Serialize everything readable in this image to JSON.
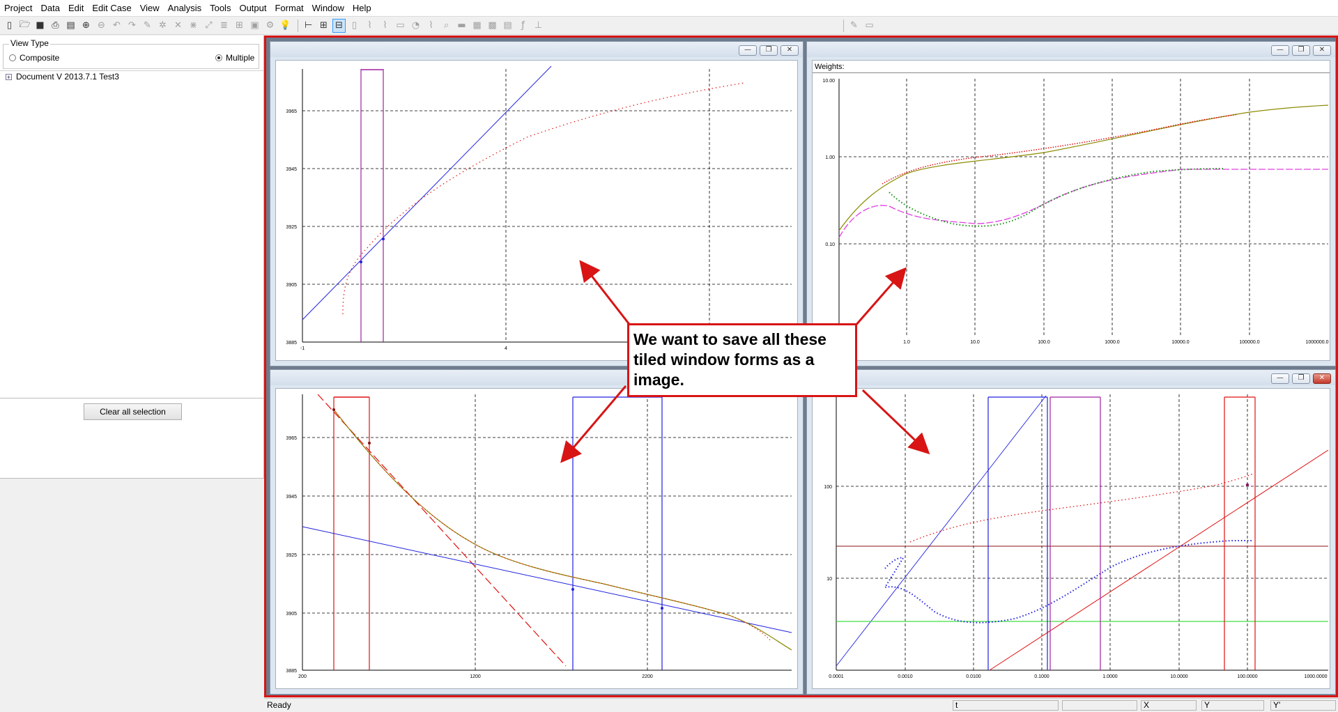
{
  "menu": [
    "Project",
    "Data",
    "Edit",
    "Edit Case",
    "View",
    "Analysis",
    "Tools",
    "Output",
    "Format",
    "Window",
    "Help"
  ],
  "left_panel": {
    "view_type_title": "View Type",
    "option_composite": "Composite",
    "option_multiple": "Multiple",
    "selected_option": "Multiple",
    "tree_root": "Document V 2013.7.1 Test3",
    "tree_expander": "+",
    "clear_button": "Clear all selection"
  },
  "windows": {
    "top_left": {
      "y_ticks": [
        "3965",
        "3945",
        "3925",
        "3905",
        "3885"
      ],
      "x_ticks": [
        "-1",
        "4"
      ]
    },
    "top_right": {
      "header": "Weights:",
      "y_ticks": [
        "10.00",
        "1.00",
        "0.10"
      ],
      "x_ticks": [
        "1.0",
        "10.0",
        "100.0",
        "1000.0",
        "10000.0",
        "100000.0",
        "1000000.0"
      ]
    },
    "bottom_left": {
      "y_ticks": [
        "3965",
        "3945",
        "3925",
        "3905",
        "3885"
      ],
      "x_ticks": [
        "200",
        "1200",
        "2200"
      ]
    },
    "bottom_right": {
      "y_ticks": [
        "100",
        "10"
      ],
      "x_ticks": [
        "0.0001",
        "0.0010",
        "0.0100",
        "0.1000",
        "1.0000",
        "10.0000",
        "100.0000",
        "1000.0000"
      ]
    }
  },
  "window_buttons": {
    "minimize": "—",
    "restore": "❐",
    "close": "✕"
  },
  "annotation": {
    "text": "We want to save all these tiled window forms as a image.",
    "color": "#d81414"
  },
  "status": {
    "ready": "Ready",
    "cells": [
      "t",
      "X",
      "Y",
      "Y'"
    ]
  },
  "colors": {
    "series_red": "#e01010",
    "series_blue": "#2020e0",
    "series_purple": "#a020a0",
    "series_green": "#109010",
    "series_magenta": "#e040e0",
    "series_olive": "#8a8a00",
    "series_darkred": "#8b1010",
    "series_lightgreen": "#40e040"
  }
}
